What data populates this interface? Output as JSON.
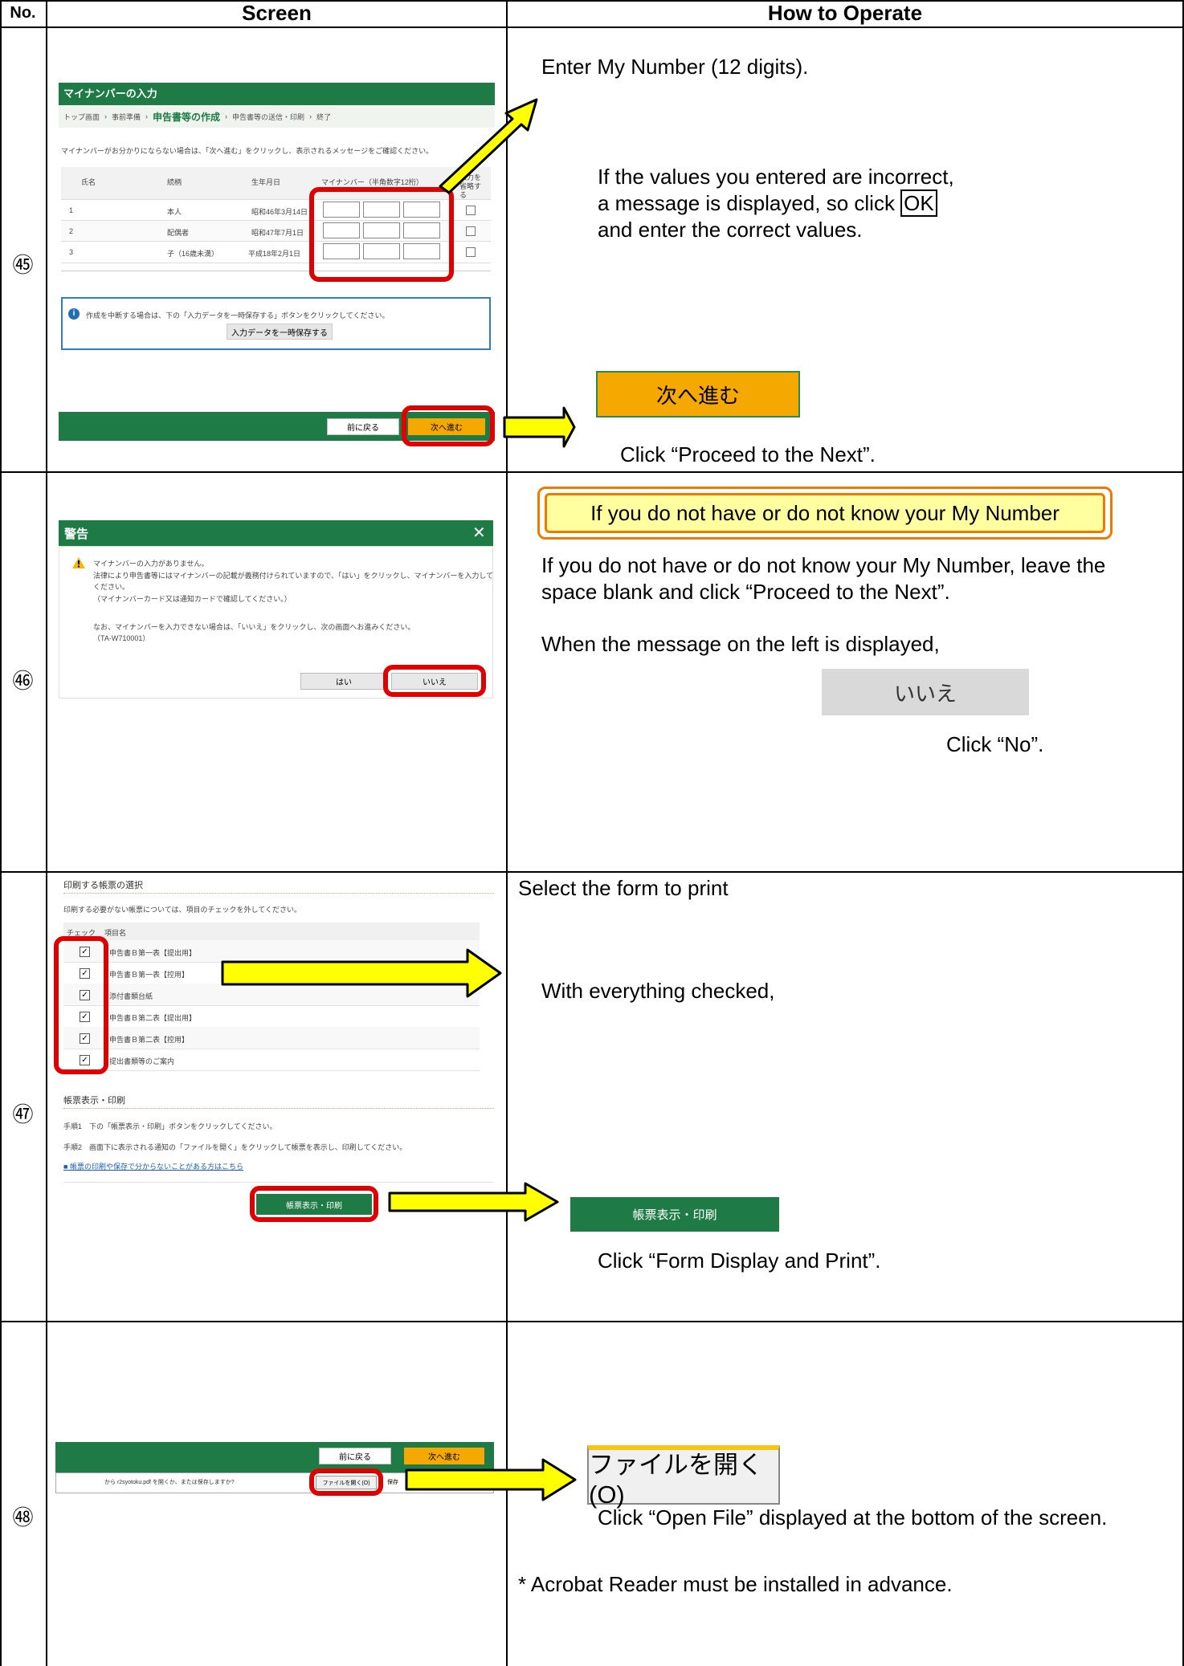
{
  "header": {
    "no": "No.",
    "screen": "Screen",
    "how": "How to Operate"
  },
  "rows": {
    "r45": {
      "num": "㊺",
      "shot": {
        "title": "マイナンバーの入力",
        "crumb1": "トップ画面",
        "crumb2": "事前準備",
        "crumb3": "申告書等の作成",
        "crumb4": "申告書等の送信・印刷",
        "crumb5": "終了",
        "note": "マイナンバーがお分かりにならない場合は、「次へ進む」をクリックし、表示されるメッセージをご確認ください。",
        "cols": [
          "氏名",
          "続柄",
          "生年月日",
          "マイナンバー（半角数字12桁）",
          "入力を省略する"
        ],
        "people": [
          {
            "rel": "本人",
            "dob": "昭和46年3月14日"
          },
          {
            "rel": "配偶者",
            "dob": "昭和47年7月1日"
          },
          {
            "rel": "子（16歳未満）",
            "dob": "平成18年2月1日"
          }
        ],
        "row_nums": [
          "1",
          "2",
          "3"
        ],
        "info": "作成を中断する場合は、下の「入力データを一時保存する」ボタンをクリックしてください。",
        "save_btn": "入力データを一時保存する",
        "back_btn": "前に戻る",
        "next_btn": "次へ進む"
      },
      "how": {
        "line1": "Enter My Number (12 digits).",
        "err1": "If the values you entered are incorrect,",
        "err2a": "a message is displayed, so click ",
        "err2b": "OK",
        "err3": "and enter the correct values.",
        "big_btn": "次へ進む",
        "click": "Click “Proceed to the Next”."
      }
    },
    "r46": {
      "num": "㊻",
      "shot": {
        "title": "警告",
        "close": "✕",
        "warn_icon": "warning-icon",
        "l1": "マイナンバーの入力がありません。",
        "l2": "法律により申告書等にはマイナンバーの記載が義務付けられていますので、「はい」をクリックし、マイナンバーを入力して",
        "l3": "ください。",
        "l4": "（マイナンバーカード又は通知カードで確認してください。）",
        "l5": "なお、マイナンバーを入力できない場合は、「いいえ」をクリックし、次の画面へお進みください。",
        "l6": "（TA-W710001）",
        "yes": "はい",
        "no": "いいえ"
      },
      "how": {
        "banner": "If you do not have or do not know your My Number",
        "p1": "If you do not have or do not know your My Number, leave the",
        "p2": "space blank and click “Proceed to the Next”.",
        "p3": "When the message on the left is displayed,",
        "btn": "いいえ",
        "click": "Click “No”."
      }
    },
    "r47": {
      "num": "㊼",
      "shot": {
        "sec1": "印刷する帳票の選択",
        "sub1": "印刷する必要がない帳票については、項目のチェックを外してください。",
        "col_check": "チェック",
        "col_item": "項目名",
        "items": [
          "申告書Ｂ第一表【提出用】",
          "申告書Ｂ第一表【控用】",
          "添付書類台紙",
          "申告書Ｂ第二表【提出用】",
          "申告書Ｂ第二表【控用】",
          "提出書類等のご案内"
        ],
        "check_mark": "✓",
        "sec2": "帳票表示・印刷",
        "step1": "手順1　下の「帳票表示・印刷」ボタンをクリックしてください。",
        "step2": "手順2　画面下に表示される通知の「ファイルを開く」をクリックして帳票を表示し、印刷してください。",
        "link": "帳票の印刷や保存で分からないことがある方はこちら",
        "print_btn": "帳票表示・印刷"
      },
      "how": {
        "t1": "Select the form to print",
        "t2": "With everything checked,",
        "btn": "帳票表示・印刷",
        "click": "Click “Form Display and Print”."
      }
    },
    "r48": {
      "num": "㊽",
      "shot": {
        "back": "前に戻る",
        "next": "次へ進む",
        "bar_text": "から r2syotoku.pdf を開くか、または保存しますか?",
        "open": "ファイルを開く(O)",
        "save": "保存"
      },
      "how": {
        "btn": "ファイルを開く(O)",
        "click": "Click “Open File” displayed at the bottom of the screen.",
        "note": "* Acrobat Reader must be installed in advance."
      }
    }
  },
  "colors": {
    "green": "#1e7b45",
    "orange": "#f5a800",
    "red": "#e00000",
    "yellow": "#ffff00",
    "grey_btn": "#d9d9d9"
  }
}
